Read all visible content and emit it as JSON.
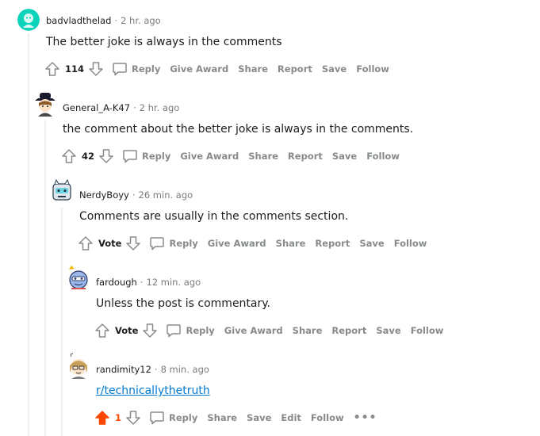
{
  "comments": [
    {
      "author": "badvladthelad",
      "time": "2 hr. ago",
      "body": "The better joke is always in the comments",
      "score": "114",
      "actions": [
        "Reply",
        "Give Award",
        "Share",
        "Report",
        "Save",
        "Follow"
      ]
    },
    {
      "author": "General_A-K47",
      "time": "2 hr. ago",
      "body": "the comment about the better joke is always in the comments.",
      "score": "42",
      "actions": [
        "Reply",
        "Give Award",
        "Share",
        "Report",
        "Save",
        "Follow"
      ]
    },
    {
      "author": "NerdyBoyy",
      "time": "26 min. ago",
      "body": "Comments are usually in the comments section.",
      "score": "Vote",
      "actions": [
        "Reply",
        "Give Award",
        "Share",
        "Report",
        "Save",
        "Follow"
      ]
    },
    {
      "author": "fardough",
      "time": "12 min. ago",
      "body": "Unless the post is commentary.",
      "score": "Vote",
      "actions": [
        "Reply",
        "Give Award",
        "Share",
        "Report",
        "Save",
        "Follow"
      ]
    },
    {
      "author": "randimity12",
      "time": "8 min. ago",
      "body": "r/technicallythetruth",
      "score": "1",
      "actions": [
        "Reply",
        "Share",
        "Save",
        "Edit",
        "Follow"
      ],
      "more": "•••"
    }
  ],
  "separator": "·",
  "colors": {
    "upvote_active": "#ff4500",
    "link": "#0079d3",
    "muted": "#878a8c",
    "avatar_1": "#0dd3bb"
  },
  "icons": {
    "upvote": "arrow-up-icon",
    "downvote": "arrow-down-icon",
    "reply": "speech-bubble-icon",
    "more": "more-options-icon"
  }
}
